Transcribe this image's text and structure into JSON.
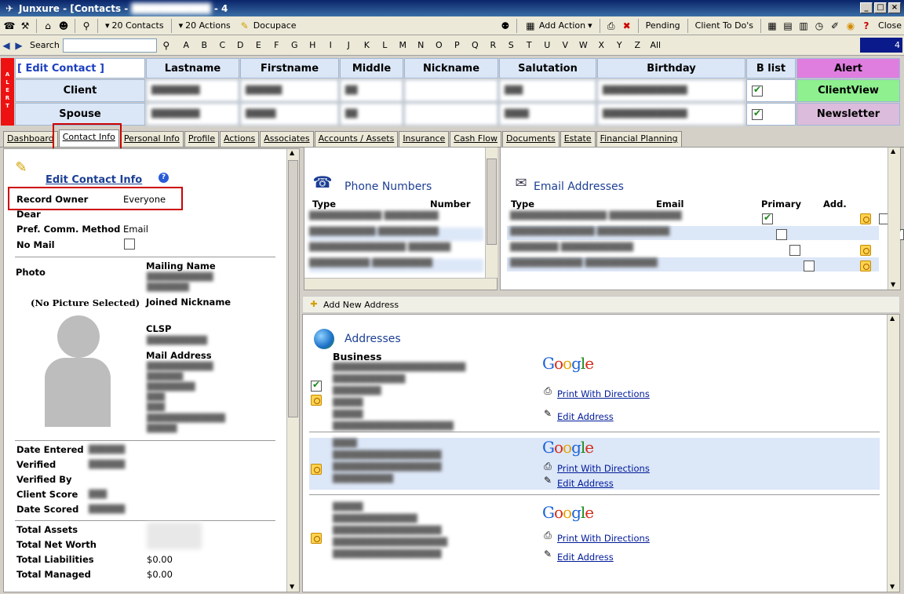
{
  "window": {
    "title": "Junxure - [Contacts - ",
    "title_suffix": "- 4"
  },
  "toolbar": {
    "contacts_label": "20 Contacts",
    "actions_label": "20 Actions",
    "docupace_label": "Docupace",
    "add_action_label": "Add Action",
    "pending_label": "Pending",
    "client_todos_label": "Client To Do's",
    "close_label": "Close"
  },
  "alphabar": {
    "search_label": "Search",
    "letters": [
      "A",
      "B",
      "C",
      "D",
      "E",
      "F",
      "G",
      "H",
      "I",
      "J",
      "K",
      "L",
      "M",
      "N",
      "O",
      "P",
      "Q",
      "R",
      "S",
      "T",
      "U",
      "V",
      "W",
      "X",
      "Y",
      "Z",
      "All"
    ],
    "page_count": "4"
  },
  "contact_grid": {
    "alert_strip": "ALERT",
    "edit_contact_label": "[ Edit Contact ]",
    "columns": [
      "Lastname",
      "Firstname",
      "Middle",
      "Nickname",
      "Salutation",
      "Birthday",
      "B list"
    ],
    "rows": [
      {
        "label": "Client",
        "b_list": true
      },
      {
        "label": "Spouse",
        "b_list": true
      }
    ],
    "alert_button": "Alert",
    "clientview_button": "ClientView",
    "newsletter_button": "Newsletter",
    "colors": {
      "alert": "#e07ee0",
      "clientview": "#8ef08e",
      "newsletter": "#dcbcdc"
    }
  },
  "tabs": [
    "Dashboard",
    "Contact Info",
    "Personal Info",
    "Profile",
    "Actions",
    "Associates",
    "Accounts / Assets",
    "Insurance",
    "Cash Flow",
    "Documents",
    "Estate",
    "Financial Planning"
  ],
  "active_tab": "Contact Info",
  "contact_info": {
    "edit_label": "Edit Contact Info",
    "record_owner_label": "Record Owner",
    "record_owner_value": "Everyone",
    "dear_label": "Dear",
    "pref_comm_label": "Pref. Comm. Method",
    "pref_comm_value": "Email",
    "no_mail_label": "No Mail",
    "photo_label": "Photo",
    "no_picture": "(No Picture Selected)",
    "mailing_name_label": "Mailing Name",
    "joined_nickname_label": "Joined Nickname",
    "clsp_label": "CLSP",
    "mail_address_label": "Mail Address",
    "date_entered_label": "Date Entered",
    "verified_label": "Verified",
    "verified_by_label": "Verified By",
    "client_score_label": "Client Score",
    "date_scored_label": "Date Scored",
    "total_assets_label": "Total Assets",
    "total_net_worth_label": "Total Net Worth",
    "total_liabilities_label": "Total Liabilities",
    "total_liabilities_value": "$0.00",
    "total_managed_label": "Total Managed",
    "total_managed_value": "$0.00"
  },
  "phone_numbers": {
    "title": "Phone Numbers",
    "col_type": "Type",
    "col_number": "Number"
  },
  "email_addresses": {
    "title": "Email Addresses",
    "col_type": "Type",
    "col_email": "Email",
    "col_primary": "Primary",
    "col_add": "Add.",
    "rows": [
      {
        "primary": true,
        "add": false
      },
      {
        "primary": false,
        "add": true
      },
      {
        "primary": false,
        "add": true
      },
      {
        "primary": false,
        "add": true
      }
    ]
  },
  "addresses": {
    "add_new_label": "Add New Address",
    "title": "Addresses",
    "first_type": "Business",
    "print_label": "Print With Directions",
    "edit_label": "Edit Address",
    "google_label": "Google"
  }
}
